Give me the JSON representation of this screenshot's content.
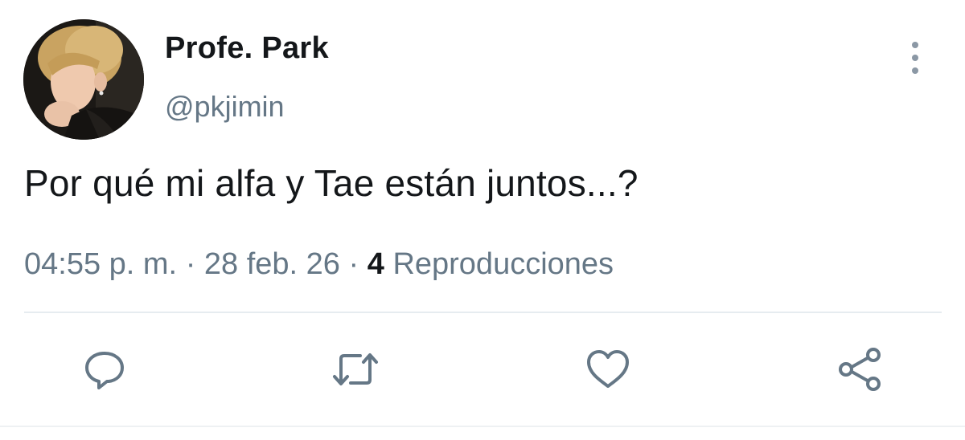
{
  "tweet": {
    "display_name": "Profe. Park",
    "handle": "@pkjimin",
    "text": "Por qué mi alfa y Tae están juntos...?",
    "time": "04:55 p. m.",
    "separator": "·",
    "date": "28 feb. 26",
    "views_count": "4",
    "views_label": "Reproducciones"
  },
  "icons": {
    "more": "more-vertical-icon",
    "reply": "reply-bubble-icon",
    "retweet": "retweet-icon",
    "like": "heart-icon",
    "share": "share-icon"
  },
  "colors": {
    "text": "#14171a",
    "secondary": "#657786",
    "icon": "#657786",
    "divider": "#e6ecf0"
  }
}
